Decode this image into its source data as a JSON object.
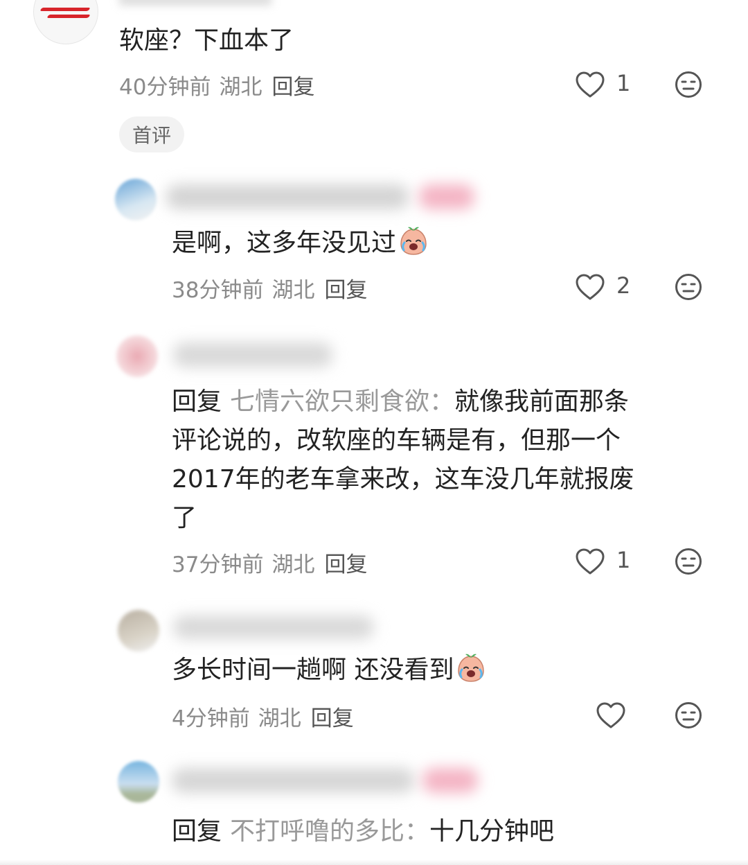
{
  "top_comment": {
    "text": "软座？下血本了",
    "time": "40分钟前",
    "location": "湖北",
    "reply_label": "回复",
    "likes": "1",
    "tag": "首评"
  },
  "replies": [
    {
      "text": "是啊，这多年没见过",
      "time": "38分钟前",
      "location": "湖北",
      "reply_label": "回复",
      "likes": "2"
    },
    {
      "reply_prefix": "回复",
      "reply_target": "七情六欲只剩食欲",
      "colon": "：",
      "lines": [
        "就像我前面那条",
        "评论说的，改软座的车辆是有，但那一个",
        "2017年的老车拿来改，这车没几年就报废",
        "了"
      ],
      "time": "37分钟前",
      "location": "湖北",
      "reply_label": "回复",
      "likes": "1"
    },
    {
      "text": "多长时间一趟啊  还没看到",
      "time": "4分钟前",
      "location": "湖北",
      "reply_label": "回复",
      "likes": ""
    },
    {
      "reply_prefix": "回复",
      "reply_target": "不打呼噜的多比",
      "colon": "：",
      "text": "十几分钟吧"
    }
  ],
  "icons": {
    "like": "heart-outline-icon",
    "dislike": "neutral-face-icon",
    "emoji": "crying-laughing-peach-emoji"
  }
}
